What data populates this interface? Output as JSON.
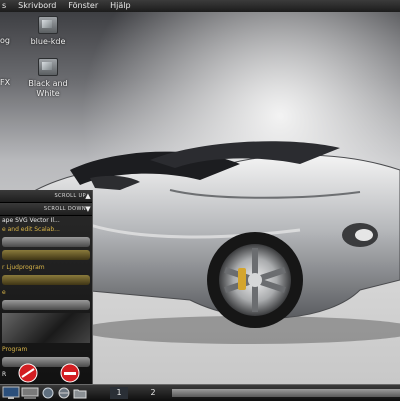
{
  "menubar": {
    "items": [
      "s",
      "Skrivbord",
      "Fönster",
      "Hjälp"
    ]
  },
  "desktop": {
    "icons": [
      {
        "label": "blue-kde"
      },
      {
        "label": "Black and White"
      }
    ],
    "partial_labels": [
      "og",
      "FX"
    ]
  },
  "side_panel": {
    "scroll_up": "SCROLL UP",
    "scroll_down": "SCROLL DOWN",
    "rows": [
      "ape SVG Vector Il...",
      "e and edit Scalab...",
      "r Ljudprogram",
      "e",
      "Program",
      "R"
    ]
  },
  "taskbar": {
    "pager": [
      "1",
      "2"
    ]
  },
  "colors": {
    "accent_gold": "#d9b548",
    "taskbar": "#1a1a1a",
    "close_red": "#d21e22"
  }
}
